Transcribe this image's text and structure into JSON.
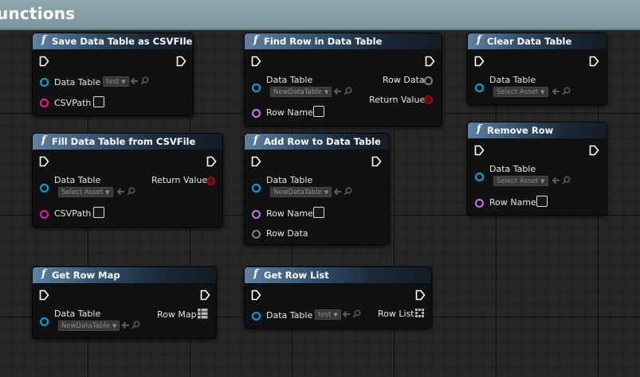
{
  "comment": {
    "title": "unctions"
  },
  "nodes": {
    "save_csv": {
      "title": "Save Data Table as CSVFIle",
      "pins": {
        "data_table": "Data Table",
        "csv_path": "CSVPath"
      },
      "asset": "test"
    },
    "fill_csv": {
      "title": "Fill Data Table from CSVFile",
      "pins": {
        "data_table": "Data Table",
        "csv_path": "CSVPath",
        "return_value": "Return Value"
      },
      "asset": "Select Asset"
    },
    "get_row_map": {
      "title": "Get Row Map",
      "pins": {
        "data_table": "Data Table",
        "row_map": "Row Map"
      },
      "asset": "NewDataTable"
    },
    "find_row": {
      "title": "Find Row in Data Table",
      "pins": {
        "data_table": "Data Table",
        "row_name": "Row Name",
        "row_data": "Row Data",
        "return_value": "Return Value"
      },
      "asset": "NewDataTable"
    },
    "add_row": {
      "title": "Add Row to Data Table",
      "pins": {
        "data_table": "Data Table",
        "row_name": "Row Name",
        "row_data": "Row Data"
      },
      "asset": "NewDataTable"
    },
    "get_row_list": {
      "title": "Get Row List",
      "pins": {
        "data_table": "Data Table",
        "row_list": "Row List"
      },
      "asset": "test"
    },
    "clear_table": {
      "title": "Clear Data Table",
      "pins": {
        "data_table": "Data Table"
      },
      "asset": "Select Asset"
    },
    "remove_row": {
      "title": "Remove Row",
      "pins": {
        "data_table": "Data Table",
        "row_name": "Row Name"
      },
      "asset": "Select Asset"
    }
  },
  "colors": {
    "object_pin": "#00a7de",
    "string_pin": "#e0209e",
    "name_pin": "#c77ae0",
    "struct_pin": "#808080",
    "bool_pin": "#950f0f",
    "header_accent": "#5d82a4",
    "comment_bar": "#8fa8ad"
  },
  "icons": {
    "function": "function-icon",
    "exec": "exec-pin-icon",
    "browse": "use-selected-asset-arrow-icon",
    "search": "browse-asset-search-icon",
    "map": "map-grid-icon",
    "array": "array-grid-icon"
  }
}
